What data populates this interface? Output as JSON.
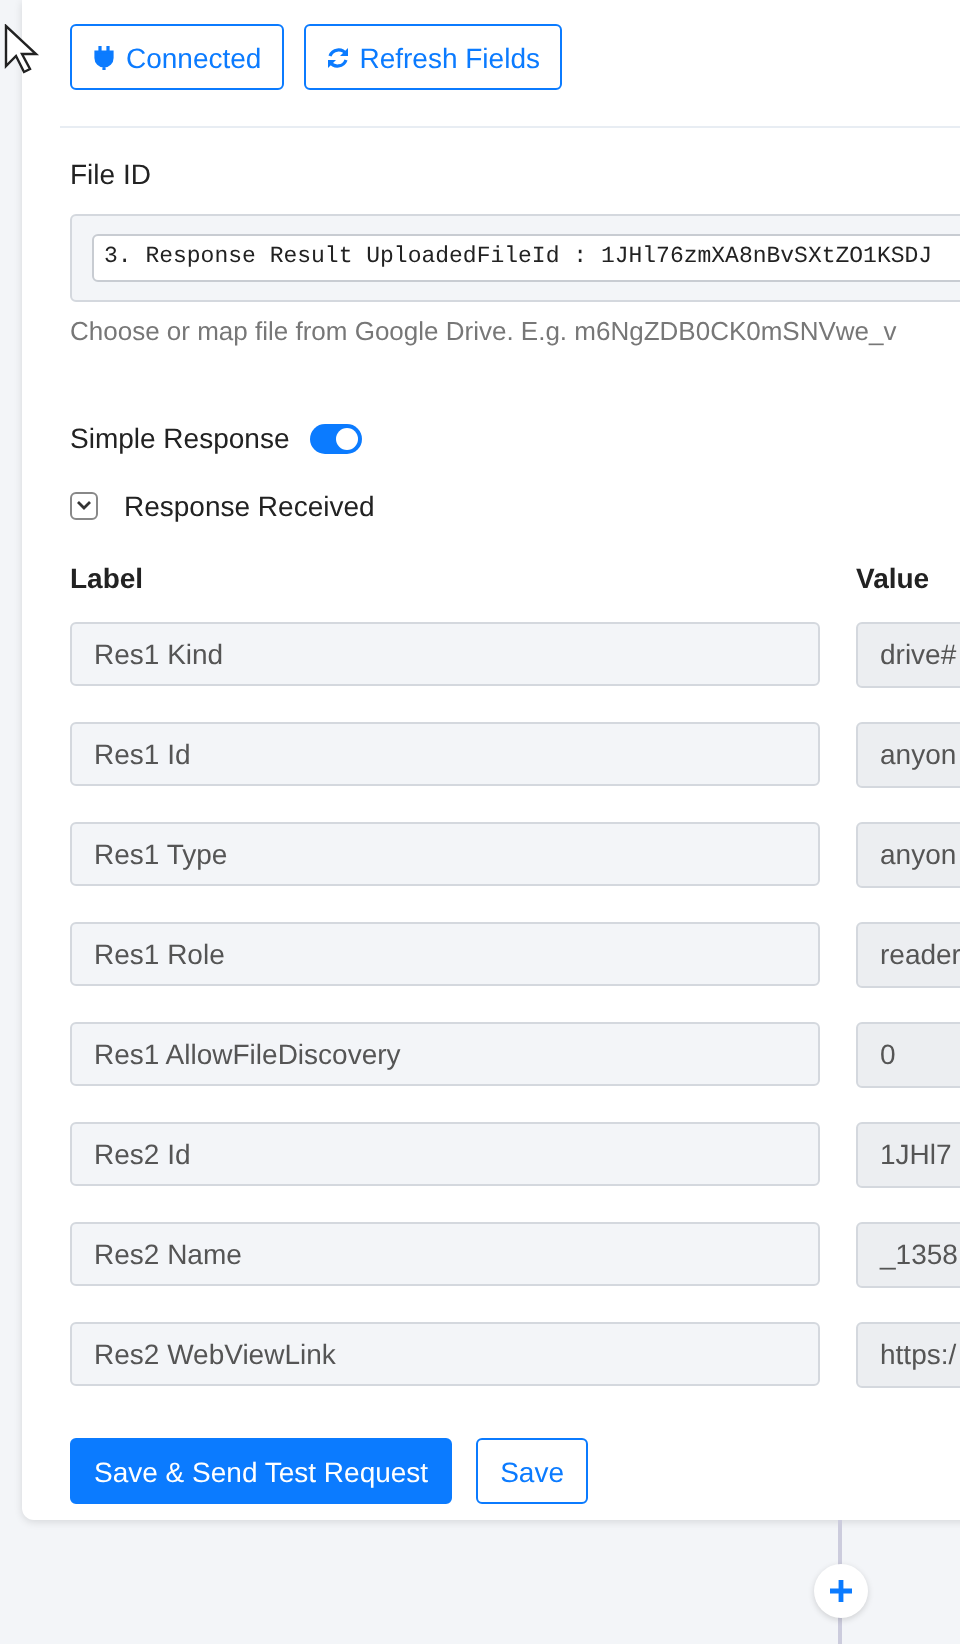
{
  "header_buttons": [
    {
      "kind": "plug",
      "label": "Connected"
    },
    {
      "kind": "refresh",
      "label": "Refresh Fields"
    }
  ],
  "file_id": {
    "label": "File ID",
    "value": "3. Response Result UploadedFileId : 1JHl76zmXA8nBvSXtZO1KSDJ",
    "helper": "Choose or map file from Google Drive. E.g. m6NgZDB0CK0mSNVwe_v"
  },
  "simple_response": {
    "label": "Simple Response",
    "on": true
  },
  "response_received": {
    "label": "Response Received",
    "expanded": true
  },
  "table": {
    "columns": [
      "Label",
      "Value"
    ],
    "rows": [
      {
        "label": "Res1 Kind",
        "value": "drive#"
      },
      {
        "label": "Res1 Id",
        "value": "anyon"
      },
      {
        "label": "Res1 Type",
        "value": "anyon"
      },
      {
        "label": "Res1 Role",
        "value": "reader"
      },
      {
        "label": "Res1 AllowFileDiscovery",
        "value": "0"
      },
      {
        "label": "Res2 Id",
        "value": "1JHl7"
      },
      {
        "label": "Res2 Name",
        "value": "_1358"
      },
      {
        "label": "Res2 WebViewLink",
        "value": "https:/"
      }
    ]
  },
  "buttons": [
    {
      "label": "Save & Send Test Request",
      "kind": "primary"
    },
    {
      "label": "Save",
      "kind": "outline"
    }
  ]
}
